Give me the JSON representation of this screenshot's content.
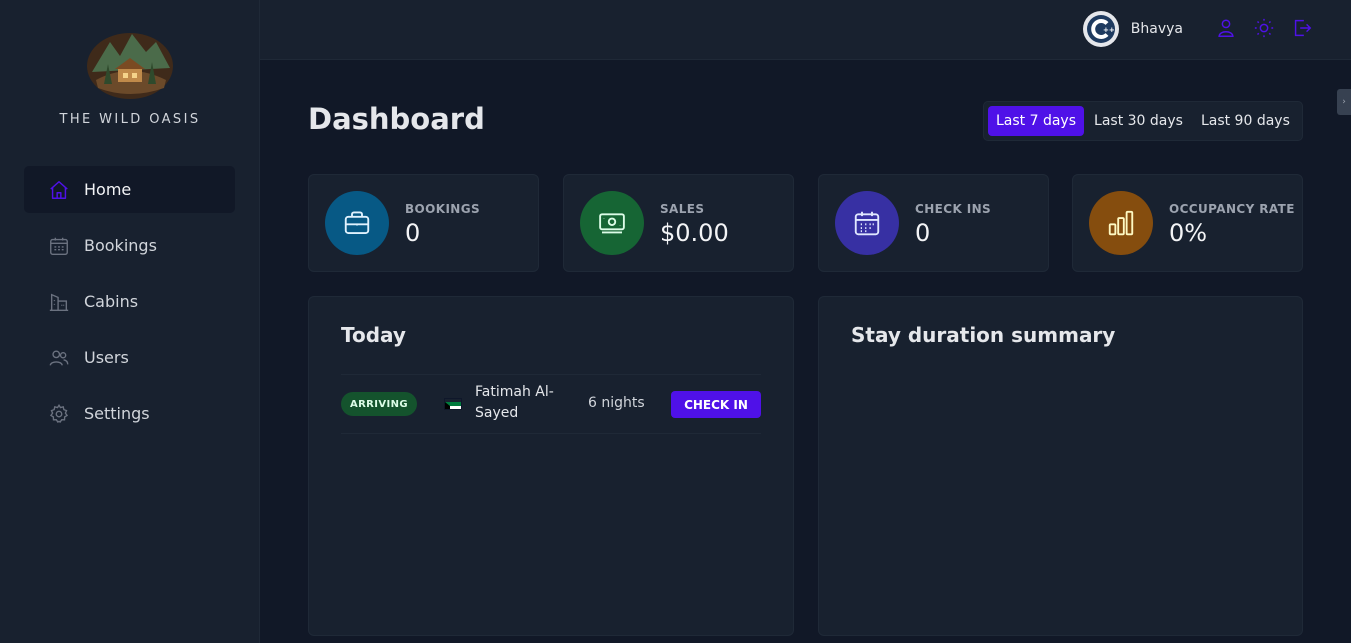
{
  "brand": {
    "name": "THE WILD OASIS"
  },
  "nav": [
    {
      "label": "Home",
      "icon": "home-icon",
      "active": true
    },
    {
      "label": "Bookings",
      "icon": "calendar-icon",
      "active": false
    },
    {
      "label": "Cabins",
      "icon": "building-icon",
      "active": false
    },
    {
      "label": "Users",
      "icon": "users-icon",
      "active": false
    },
    {
      "label": "Settings",
      "icon": "gear-icon",
      "active": false
    }
  ],
  "header": {
    "username": "Bhavya",
    "icons": [
      "user-icon",
      "sun-icon",
      "logout-icon"
    ],
    "accent_color": "#4f11e8"
  },
  "main": {
    "title": "Dashboard",
    "filter": {
      "options": [
        "Last 7 days",
        "Last 30 days",
        "Last 90 days"
      ],
      "selected": "Last 7 days"
    }
  },
  "stats": [
    {
      "label": "BOOKINGS",
      "value": "0",
      "icon": "briefcase-icon",
      "color": "#075985"
    },
    {
      "label": "SALES",
      "value": "$0.00",
      "icon": "banknotes-icon",
      "color": "#166534"
    },
    {
      "label": "CHECK INS",
      "value": "0",
      "icon": "calendar-days-icon",
      "color": "#3730a3"
    },
    {
      "label": "OCCUPANCY RATE",
      "value": "0%",
      "icon": "chart-bar-icon",
      "color": "#854d0e"
    }
  ],
  "today": {
    "title": "Today",
    "activities": [
      {
        "status": "ARRIVING",
        "guest": "Fatimah Al-Sayed",
        "nights": "6 nights",
        "action": "CHECK IN"
      }
    ]
  },
  "stay_duration": {
    "title": "Stay duration summary"
  }
}
